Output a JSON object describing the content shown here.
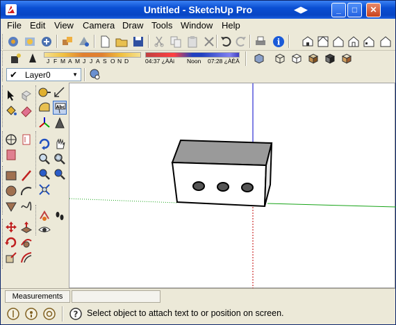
{
  "window": {
    "title": "Untitled - SketchUp Pro"
  },
  "menu": {
    "items": [
      "File",
      "Edit",
      "View",
      "Camera",
      "Draw",
      "Tools",
      "Window",
      "Help"
    ]
  },
  "shadow": {
    "months": [
      "J",
      "F",
      "M",
      "A",
      "M",
      "J",
      "J",
      "A",
      "S",
      "O",
      "N",
      "D"
    ],
    "time_start": "04:37 ¿ÀÀi",
    "time_mid": "Noon",
    "time_end": "07:28 ¿ÀÈÄ"
  },
  "layer": {
    "current": "Layer0"
  },
  "measurements": {
    "label": "Measurements",
    "value": ""
  },
  "status": {
    "text": "Select object to attach text to or position on screen."
  },
  "colors": {
    "titlebar": "#0a4ed2",
    "axis_red": "#c00000",
    "axis_green": "#16a316",
    "axis_blue": "#0000c8",
    "box_top": "#9a9a9a",
    "box_front": "#ffffff"
  }
}
